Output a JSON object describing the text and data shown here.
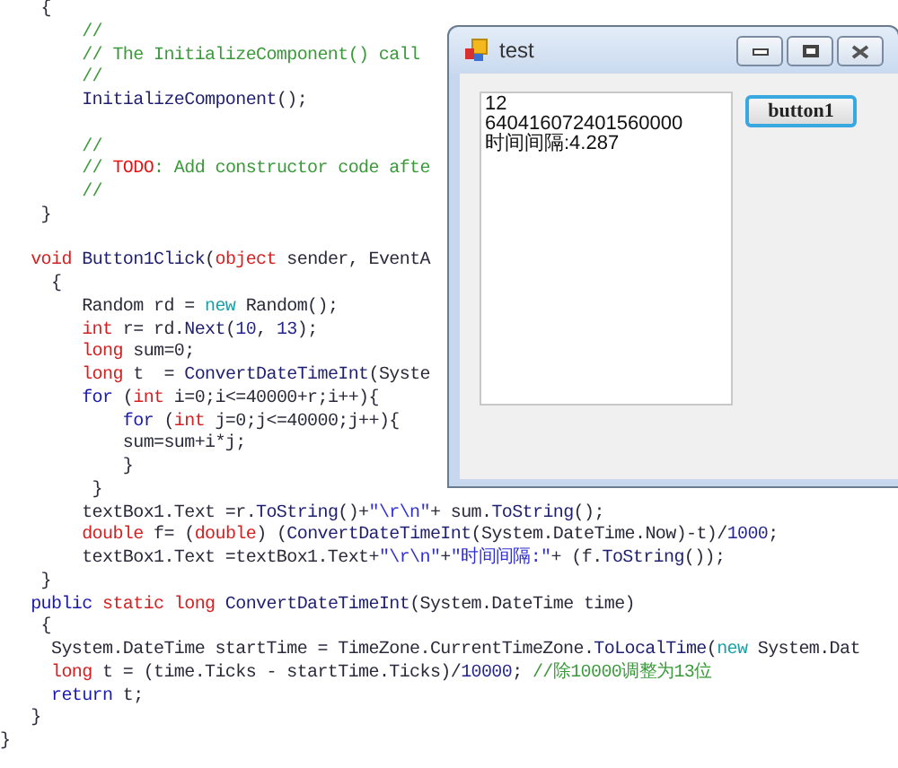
{
  "editor": {
    "lines": [
      {
        "tokens": [
          {
            "kind": "plain",
            "text": "    {"
          }
        ]
      },
      {
        "tokens": [
          {
            "kind": "comment",
            "text": "        //"
          }
        ]
      },
      {
        "tokens": [
          {
            "kind": "comment",
            "text": "        // The InitializeComponent() call"
          }
        ]
      },
      {
        "tokens": [
          {
            "kind": "comment",
            "text": "        //"
          }
        ]
      },
      {
        "tokens": [
          {
            "kind": "method",
            "text": "        InitializeComponent"
          },
          {
            "kind": "plain",
            "text": "();"
          }
        ]
      },
      {
        "kind": "blank"
      },
      {
        "tokens": [
          {
            "kind": "comment",
            "text": "        //"
          }
        ]
      },
      {
        "tokens": [
          {
            "kind": "comment",
            "text": "        // "
          },
          {
            "kind": "todo",
            "text": "TODO"
          },
          {
            "kind": "comment",
            "text": ": Add constructor code afte"
          }
        ]
      },
      {
        "tokens": [
          {
            "kind": "comment",
            "text": "        //"
          }
        ]
      },
      {
        "tokens": [
          {
            "kind": "plain",
            "text": "    }"
          }
        ]
      },
      {
        "kind": "blank"
      },
      {
        "tokens": [
          {
            "kind": "keyword",
            "text": "   void"
          },
          {
            "kind": "method",
            "text": " Button1Click"
          },
          {
            "kind": "plain",
            "text": "("
          },
          {
            "kind": "keyword",
            "text": "object"
          },
          {
            "kind": "plain",
            "text": " sender, EventA"
          }
        ]
      },
      {
        "tokens": [
          {
            "kind": "plain",
            "text": "     {"
          }
        ]
      },
      {
        "tokens": [
          {
            "kind": "plain",
            "text": "        Random rd = "
          },
          {
            "kind": "new",
            "text": "new"
          },
          {
            "kind": "plain",
            "text": " Random();"
          }
        ]
      },
      {
        "tokens": [
          {
            "kind": "keyword",
            "text": "        int"
          },
          {
            "kind": "plain",
            "text": " r= rd."
          },
          {
            "kind": "method",
            "text": "Next"
          },
          {
            "kind": "plain",
            "text": "("
          },
          {
            "kind": "number",
            "text": "10"
          },
          {
            "kind": "plain",
            "text": ", "
          },
          {
            "kind": "number",
            "text": "13"
          },
          {
            "kind": "plain",
            "text": ");"
          }
        ]
      },
      {
        "tokens": [
          {
            "kind": "keyword",
            "text": "        long"
          },
          {
            "kind": "plain",
            "text": " sum=0;"
          }
        ]
      },
      {
        "tokens": [
          {
            "kind": "keyword",
            "text": "        long"
          },
          {
            "kind": "plain",
            "text": " t  = "
          },
          {
            "kind": "method",
            "text": "ConvertDateTimeInt"
          },
          {
            "kind": "plain",
            "text": "(Syste"
          }
        ]
      },
      {
        "tokens": [
          {
            "kind": "control",
            "text": "        for"
          },
          {
            "kind": "plain",
            "text": " ("
          },
          {
            "kind": "keyword",
            "text": "int"
          },
          {
            "kind": "plain",
            "text": " i=0;i<=40000+r;i++){"
          }
        ]
      },
      {
        "tokens": [
          {
            "kind": "control",
            "text": "            for"
          },
          {
            "kind": "plain",
            "text": " ("
          },
          {
            "kind": "keyword",
            "text": "int"
          },
          {
            "kind": "plain",
            "text": " j=0;j<=40000;j++){"
          }
        ]
      },
      {
        "tokens": [
          {
            "kind": "plain",
            "text": "            sum=sum+i*j;"
          }
        ]
      },
      {
        "tokens": [
          {
            "kind": "plain",
            "text": "            }"
          }
        ]
      },
      {
        "tokens": [
          {
            "kind": "plain",
            "text": "         }"
          }
        ]
      },
      {
        "tokens": [
          {
            "kind": "plain",
            "text": "        textBox1.Text =r."
          },
          {
            "kind": "method",
            "text": "ToString"
          },
          {
            "kind": "plain",
            "text": "()+"
          },
          {
            "kind": "string",
            "text": "\"\\r\\n\""
          },
          {
            "kind": "plain",
            "text": "+ sum."
          },
          {
            "kind": "method",
            "text": "ToString"
          },
          {
            "kind": "plain",
            "text": "();"
          }
        ]
      },
      {
        "tokens": [
          {
            "kind": "keyword",
            "text": "        double"
          },
          {
            "kind": "plain",
            "text": " f= ("
          },
          {
            "kind": "keyword",
            "text": "double"
          },
          {
            "kind": "plain",
            "text": ") ("
          },
          {
            "kind": "method",
            "text": "ConvertDateTimeInt"
          },
          {
            "kind": "plain",
            "text": "(System.DateTime.Now)-t)/"
          },
          {
            "kind": "number",
            "text": "1000"
          },
          {
            "kind": "plain",
            "text": ";"
          }
        ]
      },
      {
        "tokens": [
          {
            "kind": "plain",
            "text": "        textBox1.Text =textBox1.Text+"
          },
          {
            "kind": "string",
            "text": "\"\\r\\n\""
          },
          {
            "kind": "plain",
            "text": "+"
          },
          {
            "kind": "string",
            "text": "\"时间间隔:\""
          },
          {
            "kind": "plain",
            "text": "+ (f."
          },
          {
            "kind": "method",
            "text": "ToString"
          },
          {
            "kind": "plain",
            "text": "());"
          }
        ]
      },
      {
        "tokens": [
          {
            "kind": "plain",
            "text": "    }"
          }
        ]
      },
      {
        "tokens": [
          {
            "kind": "control",
            "text": "   public"
          },
          {
            "kind": "keyword",
            "text": " static long"
          },
          {
            "kind": "method",
            "text": " ConvertDateTimeInt"
          },
          {
            "kind": "plain",
            "text": "(System.DateTime time)"
          }
        ]
      },
      {
        "tokens": [
          {
            "kind": "plain",
            "text": "    {"
          }
        ]
      },
      {
        "tokens": [
          {
            "kind": "plain",
            "text": "     System.DateTime startTime = TimeZone.CurrentTimeZone."
          },
          {
            "kind": "method",
            "text": "ToLocalTime"
          },
          {
            "kind": "plain",
            "text": "("
          },
          {
            "kind": "new",
            "text": "new"
          },
          {
            "kind": "plain",
            "text": " System.Dat"
          }
        ]
      },
      {
        "tokens": [
          {
            "kind": "keyword",
            "text": "     long"
          },
          {
            "kind": "plain",
            "text": " t = (time.Ticks - startTime.Ticks)/"
          },
          {
            "kind": "number",
            "text": "10000"
          },
          {
            "kind": "plain",
            "text": "; "
          },
          {
            "kind": "comment",
            "text": "//除10000调整为13位"
          }
        ]
      },
      {
        "tokens": [
          {
            "kind": "control",
            "text": "     return"
          },
          {
            "kind": "plain",
            "text": " t;"
          }
        ]
      },
      {
        "tokens": [
          {
            "kind": "plain",
            "text": "   }"
          }
        ]
      },
      {
        "tokens": [
          {
            "kind": "plain",
            "text": "}"
          }
        ]
      }
    ]
  },
  "window": {
    "title": "test",
    "textbox": {
      "lines": [
        "12",
        "640416072401560000",
        "时间间隔:4.287"
      ]
    },
    "button": {
      "label": "button1",
      "focused": true
    }
  }
}
